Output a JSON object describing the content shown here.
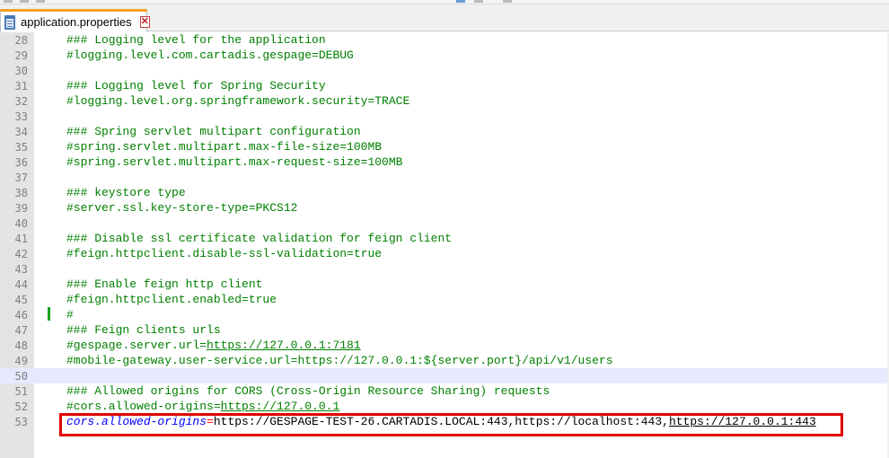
{
  "tab": {
    "label": "application.properties",
    "close_glyph": "✕",
    "icon": "file-save-icon"
  },
  "colors": {
    "comment": "#008000",
    "key": "#0000ff",
    "operator": "#ff0000",
    "value": "#000000",
    "tab_accent": "#f5a020",
    "highlight_box": "#e00000",
    "current_line": "#e8e8ff"
  },
  "lines": [
    {
      "num": "28",
      "text": "### Logging level for the application"
    },
    {
      "num": "29",
      "text": "#logging.level.com.cartadis.gespage=DEBUG"
    },
    {
      "num": "30",
      "text": ""
    },
    {
      "num": "31",
      "text": "### Logging level for Spring Security"
    },
    {
      "num": "32",
      "text": "#logging.level.org.springframework.security=TRACE"
    },
    {
      "num": "33",
      "text": ""
    },
    {
      "num": "34",
      "text": "### Spring servlet multipart configuration"
    },
    {
      "num": "35",
      "text": "#spring.servlet.multipart.max-file-size=100MB"
    },
    {
      "num": "36",
      "text": "#spring.servlet.multipart.max-request-size=100MB"
    },
    {
      "num": "37",
      "text": ""
    },
    {
      "num": "38",
      "text": "### keystore type"
    },
    {
      "num": "39",
      "text": "#server.ssl.key-store-type=PKCS12"
    },
    {
      "num": "40",
      "text": ""
    },
    {
      "num": "41",
      "text": "### Disable ssl certificate validation for feign client"
    },
    {
      "num": "42",
      "text": "#feign.httpclient.disable-ssl-validation=true"
    },
    {
      "num": "43",
      "text": ""
    },
    {
      "num": "44",
      "text": "### Enable feign http client"
    },
    {
      "num": "45",
      "text": "#feign.httpclient.enabled=true"
    },
    {
      "num": "46",
      "text": "#"
    },
    {
      "num": "47",
      "text": "### Feign clients urls"
    },
    {
      "num": "48",
      "text_prefix": "#gespage.server.url=",
      "text_url": "https://127.0.0.1:7181"
    },
    {
      "num": "49",
      "text": "#mobile-gateway.user-service.url=https://127.0.0.1:${server.port}/api/v1/users"
    },
    {
      "num": "50",
      "text": ""
    },
    {
      "num": "51",
      "text": "### Allowed origins for CORS (Cross-Origin Resource Sharing) requests"
    },
    {
      "num": "52",
      "text_prefix": "#cors.allowed-origins=",
      "text_url": "https://127.0.0.1"
    },
    {
      "num": "53",
      "key": "cors.allowed-origins",
      "op": "=",
      "value": "https://GESPAGE-TEST-26.CARTADIS.LOCAL:443,https://localhost:443,",
      "value_url": "https://127.0.0.1:443"
    }
  ]
}
